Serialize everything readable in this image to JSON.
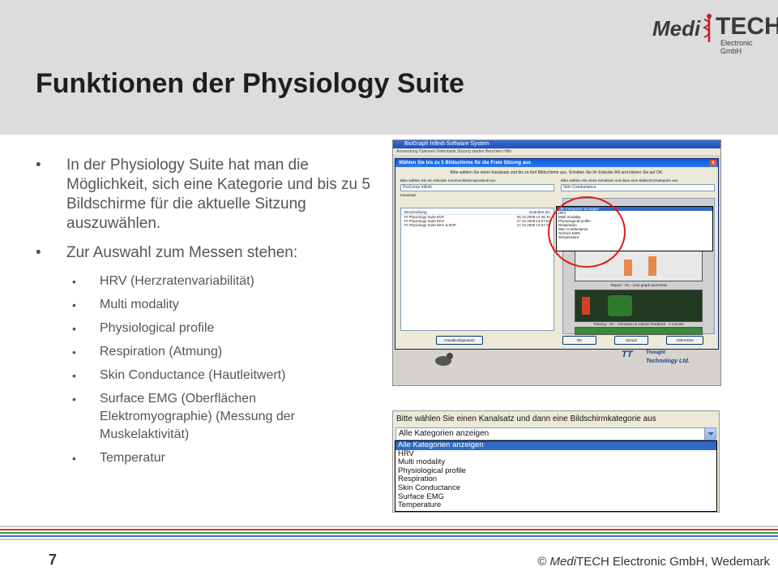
{
  "header": {
    "title": "Funktionen der Physiology Suite",
    "logo": {
      "medi": "Medi",
      "tech": "TECH",
      "sub": "Electronic GmbH"
    }
  },
  "bullets": {
    "main_1": "In der Physiology Suite hat man die Möglichkeit, sich eine Kategorie und bis zu 5 Bildschirme für die aktuelle Sitzung auszuwählen.",
    "main_2": "Zur Auswahl zum Messen stehen:",
    "sub": [
      "HRV (Herzratenvariabilität)",
      "Multi modality",
      "Physiological profile",
      "Respiration (Atmung)",
      "Skin Conductance (Hautleitwert)",
      "Surface EMG (Oberflächen Elektromyographie) (Messung der Muskelaktivität)",
      "Temperatur"
    ]
  },
  "screenshot1": {
    "window_title": "BioGraph Infiniti Software System",
    "menu": "Anwendung   Optionen   Datenbank   Sitzung starten   Berichten   Hilfe",
    "dialog_title": "Wählen Sie bis zu 5 Bildschirme für die Freie Sitzung aus",
    "close": "x",
    "hint": "Bitte wählen Sie einen Kanalsatz und bis zu fünf Bildschirme aus. Schalten Sie Ihr Enkoder AN und klicken Sie auf OK.",
    "left_label": "Bitte wählen Sie ein Enkoder Kommunikationsprotokoll aus",
    "left_combo": "ProComp Infiniti",
    "channel_label": "Kanalsatz",
    "right_label": "Bitte wählen Sie einen Kanalsatz und dann eine Bildschirmkategorie aus",
    "right_combo": "Skin Conductance",
    "columns": [
      "Beschreibung",
      "Geändert am"
    ],
    "rows": [
      {
        "name": "PI Physiology Suite BVP",
        "date": "06.10.2008 14:46:16"
      },
      {
        "name": "PI Physiology Suite EKG",
        "date": "17.10.2008 13:27:53"
      },
      {
        "name": "PI Physiology Suite EKG & BVP",
        "date": "17.10.2008 13:27:32"
      }
    ],
    "dropdown_items": [
      "Alle Kategorien anzeigen",
      "HRV",
      "Multi modality",
      "Physiological profile",
      "Respiration",
      "Skin Conductance",
      "Surface EMG",
      "Temperature"
    ],
    "caption_1": "Report : SC - Line graph and trend",
    "caption_2": "Training : SC - Animation & volume feedback - 1 monitor",
    "btn_config": "Kanalkonfiguration",
    "btn_ok": "OK",
    "btn_back": "Zurück",
    "btn_cancel": "Abbrechen",
    "brand_1": "Thought",
    "brand_2": "Technology Ltd."
  },
  "screenshot2": {
    "label": "Bitte wählen Sie einen Kanalsatz und dann eine Bildschirmkategorie aus",
    "combo_value": "Alle Kategorien anzeigen",
    "items": [
      "Alle Kategorien anzeigen",
      "HRV",
      "Multi modality",
      "Physiological profile",
      "Respiration",
      "Skin Conductance",
      "Surface EMG",
      "Temperature"
    ]
  },
  "footer": {
    "page_number": "7",
    "copyright_prefix": "© ",
    "copyright_brand": "Medi",
    "copyright_rest": "TECH Electronic GmbH, Wedemark",
    "stripe_colors": [
      "#c8c8c8",
      "#d33a3a",
      "#3b9a3b",
      "#4066c8",
      "#c8c8c8"
    ]
  }
}
